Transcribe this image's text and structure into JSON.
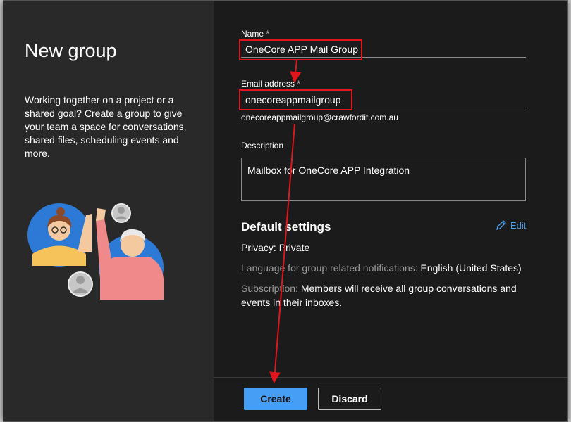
{
  "intro": {
    "title": "New group",
    "description": "Working together on a project or a shared goal? Create a group to give your team a space for conversations, shared files, scheduling events and more."
  },
  "form": {
    "name_label": "Name",
    "name_value": "OneCore APP Mail Group",
    "email_label": "Email address",
    "email_value": "onecoreappmailgroup",
    "email_full": "onecoreappmailgroup@crawfordit.com.au",
    "description_label": "Description",
    "description_value": "Mailbox for OneCore APP Integration",
    "required_marker": "*"
  },
  "default_settings": {
    "title": "Default settings",
    "edit_label": "Edit",
    "privacy_label": "Privacy:",
    "privacy_value": "Private",
    "language_label": "Language for group related notifications:",
    "language_value": "English (United States)",
    "subscription_label": "Subscription:",
    "subscription_value": "Members will receive all group conversations and events in their inboxes."
  },
  "footer": {
    "create_label": "Create",
    "discard_label": "Discard"
  },
  "colors": {
    "accent": "#479ef5",
    "annotation_red": "#e0161c",
    "link": "#4f9ee6"
  }
}
